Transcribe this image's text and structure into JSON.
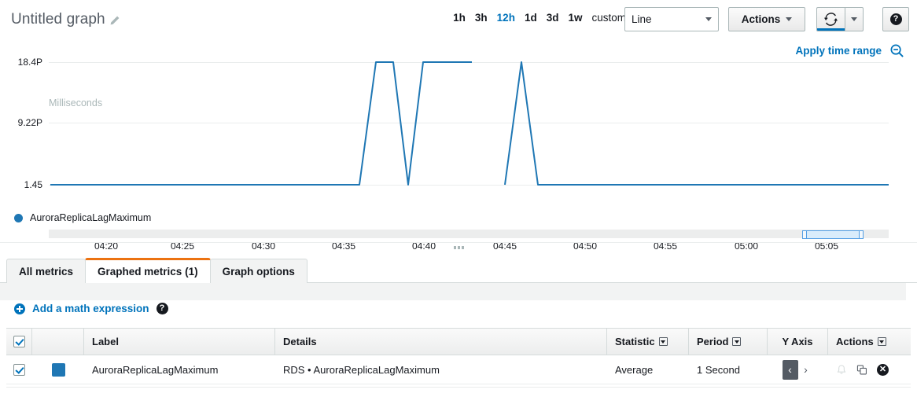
{
  "header": {
    "title": "Untitled graph",
    "edit_icon": "pencil-icon",
    "time_ranges": [
      {
        "label": "1h",
        "active": false
      },
      {
        "label": "3h",
        "active": false
      },
      {
        "label": "12h",
        "active": true
      },
      {
        "label": "1d",
        "active": false
      },
      {
        "label": "3d",
        "active": false
      },
      {
        "label": "1w",
        "active": false
      }
    ],
    "custom_label": "custom",
    "graph_type": "Line",
    "actions_label": "Actions",
    "refresh_icon": "refresh-icon",
    "help_icon": "question-mark-icon",
    "apply_time_range": "Apply time range",
    "zoom_out_icon": "zoom-out-icon"
  },
  "chart_data": {
    "type": "line",
    "title": "",
    "xlabel": "",
    "ylabel": "Milliseconds",
    "ytick_labels": [
      "18.4P",
      "9.22P",
      "1.45"
    ],
    "yticks": [
      18.4,
      9.22,
      1.45
    ],
    "ylim": [
      1.45,
      18.4
    ],
    "xtick_labels": [
      "04:20",
      "04:25",
      "04:30",
      "04:35",
      "04:40",
      "04:45",
      "04:50",
      "04:55",
      "05:00",
      "05:05"
    ],
    "grid": true,
    "legend_position": "bottom-left",
    "series": [
      {
        "name": "AuroraReplicaLagMaximum",
        "color": "#1f77b4",
        "segments": [
          {
            "points": [
              {
                "t": "04:17",
                "v": 1.45
              },
              {
                "t": "04:36",
                "v": 1.45
              },
              {
                "t": "04:37",
                "v": 18.4
              },
              {
                "t": "04:38",
                "v": 18.4
              },
              {
                "t": "04:39",
                "v": 1.45
              },
              {
                "t": "04:40",
                "v": 18.4
              },
              {
                "t": "04:43",
                "v": 18.4
              }
            ]
          },
          {
            "points": [
              {
                "t": "04:45",
                "v": 1.45
              },
              {
                "t": "04:46",
                "v": 18.4
              },
              {
                "t": "04:47",
                "v": 1.45
              },
              {
                "t": "05:09",
                "v": 1.45
              }
            ]
          }
        ]
      }
    ],
    "legend": [
      "AuroraReplicaLagMaximum"
    ],
    "brush": {
      "from": "05:03",
      "to": "05:07"
    }
  },
  "tabs": [
    {
      "label": "All metrics",
      "active": false
    },
    {
      "label": "Graphed metrics (1)",
      "active": true
    },
    {
      "label": "Graph options",
      "active": false
    }
  ],
  "math": {
    "add_label": "Add a math expression",
    "plus_icon": "plus-circle-icon",
    "help_icon": "question-mark-icon"
  },
  "table": {
    "columns": [
      {
        "key": "check",
        "label": ""
      },
      {
        "key": "color",
        "label": ""
      },
      {
        "key": "label",
        "label": "Label"
      },
      {
        "key": "details",
        "label": "Details"
      },
      {
        "key": "statistic",
        "label": "Statistic"
      },
      {
        "key": "period",
        "label": "Period"
      },
      {
        "key": "yaxis",
        "label": "Y Axis"
      },
      {
        "key": "actions",
        "label": "Actions"
      }
    ],
    "header_checkbox_checked": true,
    "rows": [
      {
        "checked": true,
        "color": "#1f77b4",
        "label": "AuroraReplicaLagMaximum",
        "details": "RDS • AuroraReplicaLagMaximum",
        "statistic": "Average",
        "period": "1 Second",
        "yaxis_left": "‹",
        "yaxis_right": "›",
        "actions_icons": [
          "bell-icon",
          "duplicate-icon",
          "remove-icon"
        ]
      }
    ]
  }
}
